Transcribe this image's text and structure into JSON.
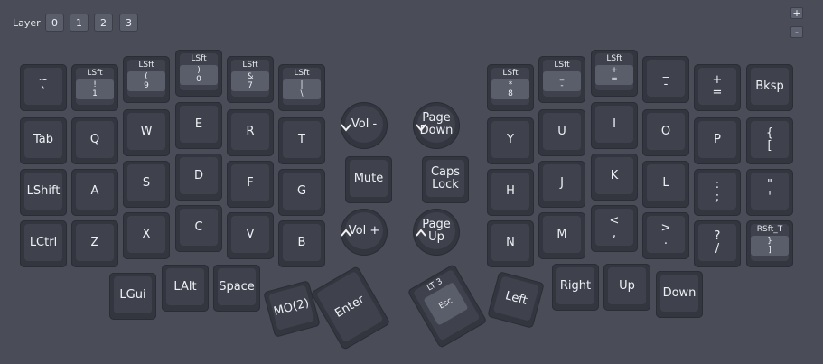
{
  "layer_bar": {
    "label": "Layer",
    "buttons": [
      "0",
      "1",
      "2",
      "3"
    ]
  },
  "zoom": {
    "plus": "+",
    "minus": "-"
  },
  "keys": {
    "grave": {
      "lines": [
        "~",
        "`"
      ]
    },
    "k1": {
      "mod": "LSft",
      "lines": [
        "!",
        "1"
      ]
    },
    "k2": {
      "mod": "LSft",
      "lines": [
        "(",
        "9"
      ]
    },
    "k3": {
      "mod": "LSft",
      "lines": [
        ")",
        "0"
      ]
    },
    "k4": {
      "mod": "LSft",
      "lines": [
        "&",
        "7"
      ]
    },
    "k5": {
      "mod": "LSft",
      "lines": [
        "|",
        "\\"
      ]
    },
    "tab": {
      "lines": [
        "Tab"
      ]
    },
    "q": {
      "lines": [
        "Q"
      ]
    },
    "w": {
      "lines": [
        "W"
      ]
    },
    "e": {
      "lines": [
        "E"
      ]
    },
    "r": {
      "lines": [
        "R"
      ]
    },
    "t": {
      "lines": [
        "T"
      ]
    },
    "lshift": {
      "lines": [
        "LShift"
      ]
    },
    "a": {
      "lines": [
        "A"
      ]
    },
    "s": {
      "lines": [
        "S"
      ]
    },
    "d": {
      "lines": [
        "D"
      ]
    },
    "f": {
      "lines": [
        "F"
      ]
    },
    "g": {
      "lines": [
        "G"
      ]
    },
    "lctrl": {
      "lines": [
        "LCtrl"
      ]
    },
    "z": {
      "lines": [
        "Z"
      ]
    },
    "x": {
      "lines": [
        "X"
      ]
    },
    "c": {
      "lines": [
        "C"
      ]
    },
    "v": {
      "lines": [
        "V"
      ]
    },
    "b": {
      "lines": [
        "B"
      ]
    },
    "lgui": {
      "lines": [
        "LGui"
      ]
    },
    "lalt": {
      "lines": [
        "LAlt"
      ]
    },
    "space": {
      "lines": [
        "Space"
      ]
    },
    "mo2": {
      "lines": [
        "MO(2)"
      ]
    },
    "enter": {
      "lines": [
        "Enter"
      ]
    },
    "voldown": {
      "lines": [
        "Vol -"
      ]
    },
    "mute": {
      "lines": [
        "Mute"
      ]
    },
    "volup": {
      "lines": [
        "Vol +"
      ]
    },
    "pgdn": {
      "lines": [
        "Page",
        "Down"
      ]
    },
    "caps": {
      "lines": [
        "Caps",
        "Lock"
      ]
    },
    "pgup": {
      "lines": [
        "Page",
        "Up"
      ]
    },
    "k6": {
      "mod": "LSft",
      "lines": [
        "*",
        "8"
      ]
    },
    "k7": {
      "mod": "LSft",
      "lines": [
        "_",
        "-"
      ]
    },
    "k8": {
      "mod": "LSft",
      "lines": [
        "+",
        "="
      ]
    },
    "minus": {
      "lines": [
        "_",
        "-"
      ]
    },
    "equal": {
      "lines": [
        "+",
        "="
      ]
    },
    "bksp": {
      "lines": [
        "Bksp"
      ]
    },
    "y": {
      "lines": [
        "Y"
      ]
    },
    "u": {
      "lines": [
        "U"
      ]
    },
    "i": {
      "lines": [
        "I"
      ]
    },
    "o": {
      "lines": [
        "O"
      ]
    },
    "p": {
      "lines": [
        "P"
      ]
    },
    "lbrace": {
      "lines": [
        "{",
        "["
      ]
    },
    "h": {
      "lines": [
        "H"
      ]
    },
    "j": {
      "lines": [
        "J"
      ]
    },
    "k": {
      "lines": [
        "K"
      ]
    },
    "l": {
      "lines": [
        "L"
      ]
    },
    "semi": {
      "lines": [
        ":",
        ";"
      ]
    },
    "quote": {
      "lines": [
        "\"",
        "'"
      ]
    },
    "n": {
      "lines": [
        "N"
      ]
    },
    "m": {
      "lines": [
        "M"
      ]
    },
    "comma": {
      "lines": [
        "<",
        ","
      ]
    },
    "dot": {
      "lines": [
        ">",
        "."
      ]
    },
    "slash": {
      "lines": [
        "?",
        "/"
      ]
    },
    "rbrace": {
      "mod": "RSft_T",
      "lines": [
        "}",
        "]"
      ]
    },
    "esc": {
      "mod": "LT 3",
      "lines": [
        "Esc"
      ]
    },
    "left": {
      "lines": [
        "Left"
      ]
    },
    "right": {
      "lines": [
        "Right"
      ]
    },
    "up": {
      "lines": [
        "Up"
      ]
    },
    "down": {
      "lines": [
        "Down"
      ]
    }
  },
  "icons": {
    "arrow_down": "chevron-down-icon",
    "arrow_up": "chevron-up-icon"
  }
}
